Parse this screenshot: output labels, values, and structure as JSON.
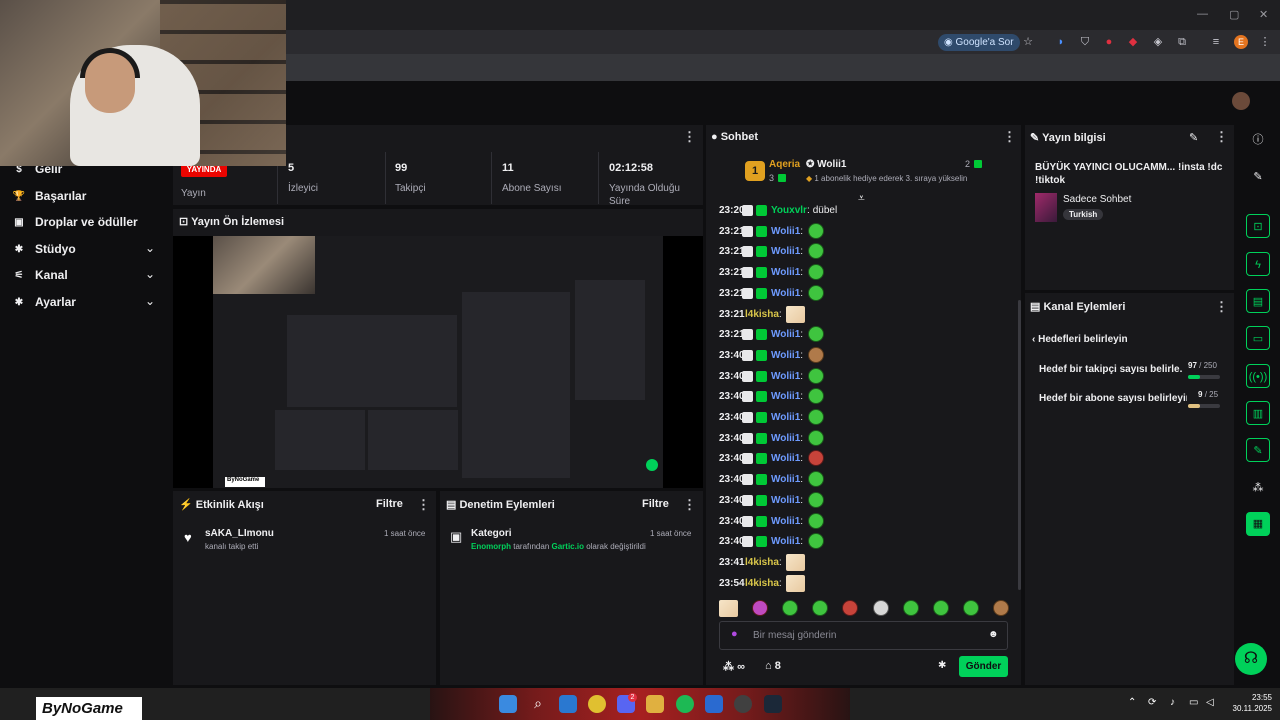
{
  "browser": {
    "google_chip": "Google'a Sor",
    "profile_initial": "E"
  },
  "nav": {
    "items": [
      {
        "label": "Gelir",
        "icon": "money-icon"
      },
      {
        "label": "Başarılar",
        "icon": "trophy-icon"
      },
      {
        "label": "Droplar ve ödüller",
        "icon": "gift-icon"
      },
      {
        "label": "Stüdyo",
        "icon": "gear-icon"
      },
      {
        "label": "Kanal",
        "icon": "sliders-icon"
      },
      {
        "label": "Ayarlar",
        "icon": "gear-icon"
      }
    ]
  },
  "stats": {
    "live_badge": "YAYINDA",
    "live_label": "Yayın",
    "viewers_value": "5",
    "viewers_label": "İzleyici",
    "followers_value": "99",
    "followers_label": "Takipçi",
    "subs_value": "11",
    "subs_label": "Abone Sayısı",
    "uptime_value": "02:12:58",
    "uptime_label": "Yayında Olduğu Süre"
  },
  "preview": {
    "title": "Yayın Ön İzlemesi"
  },
  "activity": {
    "title": "Etkinlik Akışı",
    "filter": "Filtre",
    "item_user": "sAKA_LImonu",
    "item_action": "kanalı takip etti",
    "item_time": "1 saat önce"
  },
  "moderation": {
    "title": "Denetim Eylemleri",
    "filter": "Filtre",
    "item_title": "Kategori",
    "item_actor": "Enomorph",
    "item_mid": "tarafından",
    "item_target": "Gartic.io",
    "item_end": "olarak değiştirildi",
    "item_time": "1 saat önce"
  },
  "chat": {
    "title": "Sohbet",
    "leader_rank": "1",
    "leader_name": "Aqeria",
    "leader_count": "3",
    "gifter_name": "Wolii1",
    "gifter_count": "2",
    "gifter_message": "1 abonelik hediye ederek 3. sıraya yükselin",
    "rows": [
      {
        "time": "23:20",
        "user": "Youxvlr",
        "color": "green",
        "text": "dübel",
        "emote": ""
      },
      {
        "time": "23:21",
        "user": "Wolii1",
        "color": "blue",
        "text": "",
        "emote": "green"
      },
      {
        "time": "23:21",
        "user": "Wolii1",
        "color": "blue",
        "text": "",
        "emote": "green"
      },
      {
        "time": "23:21",
        "user": "Wolii1",
        "color": "blue",
        "text": "",
        "emote": "green"
      },
      {
        "time": "23:21",
        "user": "Wolii1",
        "color": "blue",
        "text": "",
        "emote": "green"
      },
      {
        "time": "23:21",
        "user": "l4kisha",
        "color": "yellow",
        "text": "",
        "emote": "anime"
      },
      {
        "time": "23:21",
        "user": "Wolii1",
        "color": "blue",
        "text": "",
        "emote": "green"
      },
      {
        "time": "23:40",
        "user": "Wolii1",
        "color": "blue",
        "text": "",
        "emote": "brown"
      },
      {
        "time": "23:40",
        "user": "Wolii1",
        "color": "blue",
        "text": "",
        "emote": "green"
      },
      {
        "time": "23:40",
        "user": "Wolii1",
        "color": "blue",
        "text": "",
        "emote": "green"
      },
      {
        "time": "23:40",
        "user": "Wolii1",
        "color": "blue",
        "text": "",
        "emote": "green"
      },
      {
        "time": "23:40",
        "user": "Wolii1",
        "color": "blue",
        "text": "",
        "emote": "green"
      },
      {
        "time": "23:40",
        "user": "Wolii1",
        "color": "blue",
        "text": "",
        "emote": "red"
      },
      {
        "time": "23:40",
        "user": "Wolii1",
        "color": "blue",
        "text": "",
        "emote": "green"
      },
      {
        "time": "23:40",
        "user": "Wolii1",
        "color": "blue",
        "text": "",
        "emote": "green"
      },
      {
        "time": "23:40",
        "user": "Wolii1",
        "color": "blue",
        "text": "",
        "emote": "green"
      },
      {
        "time": "23:40",
        "user": "Wolii1",
        "color": "blue",
        "text": "",
        "emote": "green"
      },
      {
        "time": "23:41",
        "user": "l4kisha",
        "color": "yellow",
        "text": "",
        "emote": "anime"
      },
      {
        "time": "23:54",
        "user": "l4kisha",
        "color": "yellow",
        "text": "",
        "emote": "anime"
      }
    ],
    "placeholder": "Bir mesaj gönderin",
    "points": "∞",
    "store_count": "8",
    "send_label": "Gönder"
  },
  "stream_info": {
    "title": "Yayın bilgisi",
    "stream_title": "BÜYÜK YAYINCI OLUCAMM... !insta !dc !tiktok",
    "category": "Sadece Sohbet",
    "tag": "Turkish"
  },
  "channel_actions": {
    "title": "Kanal Eylemleri",
    "goals_title": "Hedefleri belirleyin",
    "goal1_label": "Hedef bir takipçi sayısı belirle...",
    "goal1_value": "97",
    "goal1_total": "/ 250",
    "goal1_fraction": 0.388,
    "goal2_label": "Hedef bir abone sayısı belirleyin",
    "goal2_value": "9",
    "goal2_total": "/ 25",
    "goal2_fraction": 0.36
  },
  "taskbar": {
    "brand": "ByNoGame",
    "time": "23:55",
    "date": "30.11.2025",
    "discord_badge": "2"
  },
  "colors": {
    "accent": "#00d15a",
    "live": "#eb0400",
    "user_blue": "#6e9bff"
  }
}
